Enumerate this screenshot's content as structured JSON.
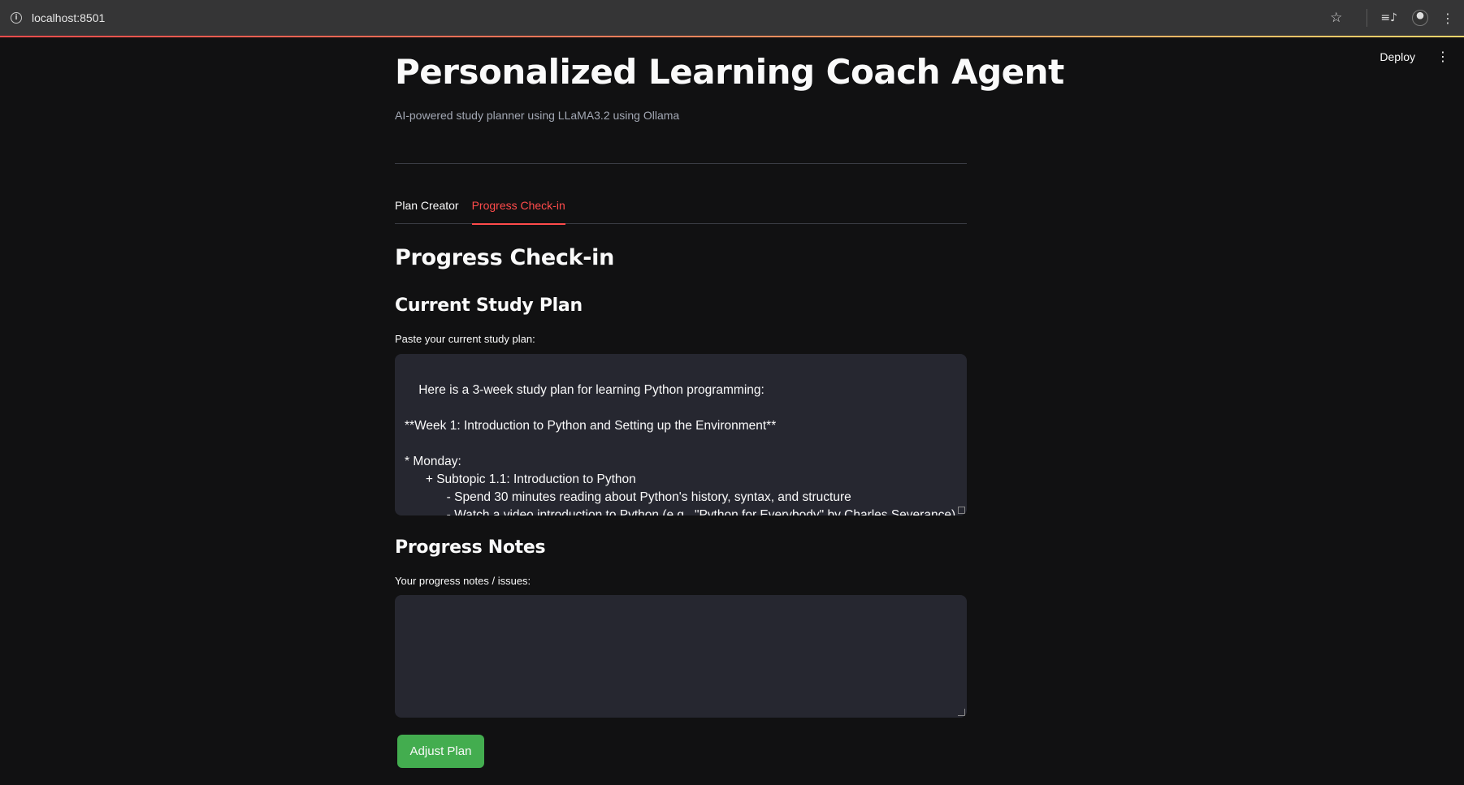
{
  "browser": {
    "url": "localhost:8501"
  },
  "app_header": {
    "deploy_label": "Deploy"
  },
  "page": {
    "title": "Personalized Learning Coach Agent",
    "subtitle": "AI-powered study planner using LLaMA3.2 using Ollama"
  },
  "tabs": [
    {
      "label": "Plan Creator",
      "active": false
    },
    {
      "label": "Progress Check-in",
      "active": true
    }
  ],
  "section": {
    "heading": "Progress Check-in",
    "plan_heading": "Current Study Plan",
    "plan_label": "Paste your current study plan:",
    "plan_value": "Here is a 3-week study plan for learning Python programming:\n\n**Week 1: Introduction to Python and Setting up the Environment**\n\n* Monday:\n      + Subtopic 1.1: Introduction to Python\n            - Spend 30 minutes reading about Python's history, syntax, and structure\n            - Watch a video introduction to Python (e.g., \"Python for Everybody\" by Charles Severance)\n            - Take notes on key points and concepts",
    "notes_heading": "Progress Notes",
    "notes_label": "Your progress notes / issues:",
    "notes_value": "",
    "button_label": "Adjust Plan"
  },
  "colors": {
    "accent": "#ff4b4b",
    "button": "#43ad4f",
    "background": "#111112",
    "input_bg": "#262730"
  }
}
